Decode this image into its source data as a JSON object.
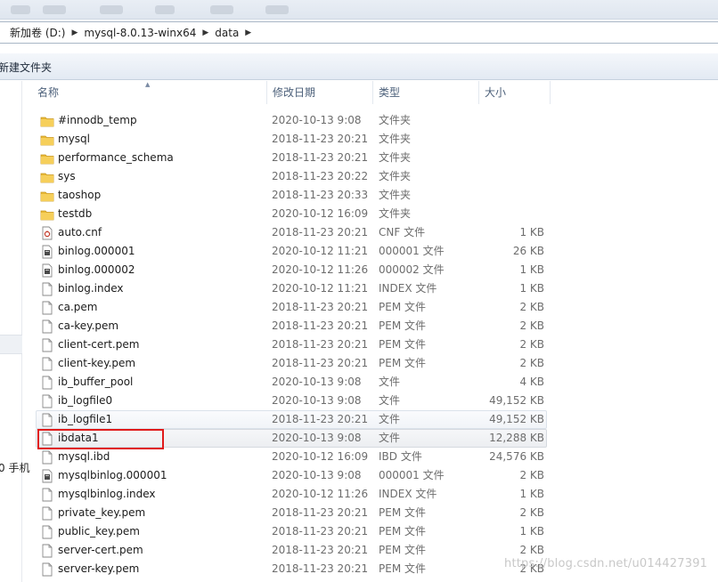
{
  "breadcrumb": [
    "新加卷 (D:)",
    "mysql-8.0.13-winx64",
    "data"
  ],
  "toolbar": {
    "new_folder": "新建文件夹"
  },
  "nav": {
    "fragment": "0 手机"
  },
  "columns": {
    "name": "名称",
    "date": "修改日期",
    "type": "类型",
    "size": "大小"
  },
  "files": [
    {
      "name": "#innodb_temp",
      "date": "2020-10-13 9:08",
      "type": "文件夹",
      "size": "",
      "icon": "folder-icon"
    },
    {
      "name": "mysql",
      "date": "2018-11-23 20:21",
      "type": "文件夹",
      "size": "",
      "icon": "folder-icon"
    },
    {
      "name": "performance_schema",
      "date": "2018-11-23 20:21",
      "type": "文件夹",
      "size": "",
      "icon": "folder-icon"
    },
    {
      "name": "sys",
      "date": "2018-11-23 20:22",
      "type": "文件夹",
      "size": "",
      "icon": "folder-icon"
    },
    {
      "name": "taoshop",
      "date": "2018-11-23 20:33",
      "type": "文件夹",
      "size": "",
      "icon": "folder-icon"
    },
    {
      "name": "testdb",
      "date": "2020-10-12 16:09",
      "type": "文件夹",
      "size": "",
      "icon": "folder-icon"
    },
    {
      "name": "auto.cnf",
      "date": "2018-11-23 20:21",
      "type": "CNF 文件",
      "size": "1 KB",
      "icon": "config-file-icon"
    },
    {
      "name": "binlog.000001",
      "date": "2020-10-12 11:21",
      "type": "000001 文件",
      "size": "26 KB",
      "icon": "binary-file-icon"
    },
    {
      "name": "binlog.000002",
      "date": "2020-10-12 11:26",
      "type": "000002 文件",
      "size": "1 KB",
      "icon": "binary-file-icon"
    },
    {
      "name": "binlog.index",
      "date": "2020-10-12 11:21",
      "type": "INDEX 文件",
      "size": "1 KB",
      "icon": "file-icon"
    },
    {
      "name": "ca.pem",
      "date": "2018-11-23 20:21",
      "type": "PEM 文件",
      "size": "2 KB",
      "icon": "file-icon"
    },
    {
      "name": "ca-key.pem",
      "date": "2018-11-23 20:21",
      "type": "PEM 文件",
      "size": "2 KB",
      "icon": "file-icon"
    },
    {
      "name": "client-cert.pem",
      "date": "2018-11-23 20:21",
      "type": "PEM 文件",
      "size": "2 KB",
      "icon": "file-icon"
    },
    {
      "name": "client-key.pem",
      "date": "2018-11-23 20:21",
      "type": "PEM 文件",
      "size": "2 KB",
      "icon": "file-icon"
    },
    {
      "name": "ib_buffer_pool",
      "date": "2020-10-13 9:08",
      "type": "文件",
      "size": "4 KB",
      "icon": "file-icon"
    },
    {
      "name": "ib_logfile0",
      "date": "2020-10-13 9:08",
      "type": "文件",
      "size": "49,152 KB",
      "icon": "file-icon"
    },
    {
      "name": "ib_logfile1",
      "date": "2018-11-23 20:21",
      "type": "文件",
      "size": "49,152 KB",
      "icon": "file-icon",
      "state": "hover"
    },
    {
      "name": "ibdata1",
      "date": "2020-10-13 9:08",
      "type": "文件",
      "size": "12,288 KB",
      "icon": "file-icon",
      "state": "selected"
    },
    {
      "name": "mysql.ibd",
      "date": "2020-10-12 16:09",
      "type": "IBD 文件",
      "size": "24,576 KB",
      "icon": "file-icon"
    },
    {
      "name": "mysqlbinlog.000001",
      "date": "2020-10-13 9:08",
      "type": "000001 文件",
      "size": "2 KB",
      "icon": "binary-file-icon"
    },
    {
      "name": "mysqlbinlog.index",
      "date": "2020-10-12 11:26",
      "type": "INDEX 文件",
      "size": "1 KB",
      "icon": "file-icon"
    },
    {
      "name": "private_key.pem",
      "date": "2018-11-23 20:21",
      "type": "PEM 文件",
      "size": "2 KB",
      "icon": "file-icon"
    },
    {
      "name": "public_key.pem",
      "date": "2018-11-23 20:21",
      "type": "PEM 文件",
      "size": "1 KB",
      "icon": "file-icon"
    },
    {
      "name": "server-cert.pem",
      "date": "2018-11-23 20:21",
      "type": "PEM 文件",
      "size": "2 KB",
      "icon": "file-icon"
    },
    {
      "name": "server-key.pem",
      "date": "2018-11-23 20:21",
      "type": "PEM 文件",
      "size": "2 KB",
      "icon": "file-icon"
    }
  ],
  "watermark": "https://blog.csdn.net/u014427391",
  "colors": {
    "folder": "#e8b936",
    "highlight": "#e01b1b",
    "accent": "#4c607a"
  }
}
